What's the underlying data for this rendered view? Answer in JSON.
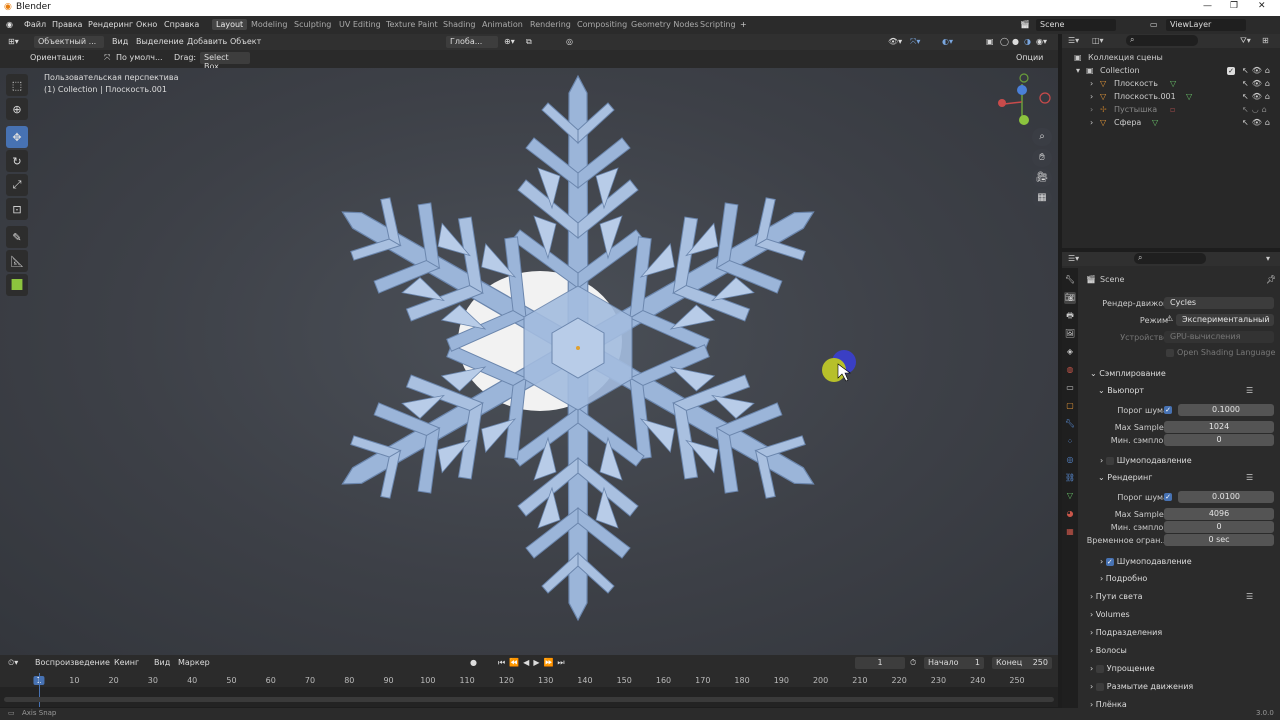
{
  "window": {
    "title": "Blender"
  },
  "menu": [
    "Файл",
    "Правка",
    "Рендеринг",
    "Окно",
    "Справка"
  ],
  "workspaces": [
    "Layout",
    "Modeling",
    "Sculpting",
    "UV Editing",
    "Texture Paint",
    "Shading",
    "Animation",
    "Rendering",
    "Compositing",
    "Geometry Nodes",
    "Scripting"
  ],
  "active_workspace": "Layout",
  "scene_field": "Scene",
  "viewlayer_field": "ViewLayer",
  "viewport_header": {
    "mode": "Объектный ...",
    "items": [
      "Вид",
      "Выделение",
      "Добавить",
      "Объект"
    ],
    "transform": "Глоба..."
  },
  "tool_header": {
    "orientation_label": "Ориентация:",
    "orientation_value": "По умолч...",
    "drag_label": "Drag:",
    "drag_value": "Select Box",
    "options": "Опции"
  },
  "viewport_info": {
    "line1": "Пользовательская перспектива",
    "line2": "(1) Collection | Плоскость.001"
  },
  "outliner": {
    "root": "Коллекция сцены",
    "collection": "Collection",
    "objects": [
      {
        "name": "Плоскость",
        "color": "#e8e8e8"
      },
      {
        "name": "Плоскость.001",
        "color": "#e8e8e8"
      },
      {
        "name": "Пустышка",
        "color": "#888888"
      },
      {
        "name": "Сфера",
        "color": "#e8e8e8"
      }
    ]
  },
  "properties": {
    "scene": "Scene",
    "render_engine_label": "Рендер-движок",
    "render_engine": "Cycles",
    "mode_label": "Режим",
    "mode": "Экспериментальный",
    "device_label": "Устройство",
    "device": "GPU-вычисления",
    "osl": "Open Shading Language",
    "sampling": "Сэмплирование",
    "viewport": "Вьюпорт",
    "noise_threshold_label": "Порог шума",
    "vp_noise": "0.1000",
    "max_samples_label": "Max Samples",
    "vp_max": "1024",
    "min_samples_label": "Мин. сэмплов",
    "vp_min": "0",
    "denoise": "Шумоподавление",
    "render": "Рендеринг",
    "r_noise": "0.0100",
    "r_max": "4096",
    "r_min": "0",
    "time_limit_label": "Временное огран...",
    "r_time": "0 sec",
    "advanced": "Подробно",
    "light_paths": "Пути света",
    "volumes": "Volumes",
    "subdivision": "Подразделения",
    "hair": "Волосы",
    "simplify": "Упрощение",
    "motion_blur": "Размытие движения",
    "film": "Плёнка"
  },
  "timeline": {
    "playback": "Воспроизведение",
    "keying": "Кеинг",
    "view": "Вид",
    "marker": "Маркер",
    "current": "1",
    "start_label": "Начало",
    "start": "1",
    "end_label": "Конец",
    "end": "250",
    "ticks": [
      "1",
      "10",
      "20",
      "30",
      "40",
      "50",
      "60",
      "70",
      "80",
      "90",
      "100",
      "110",
      "120",
      "130",
      "140",
      "150",
      "160",
      "170",
      "180",
      "190",
      "200",
      "210",
      "220",
      "230",
      "240",
      "250"
    ]
  },
  "status": {
    "left": "Axis Snap",
    "version": "3.0.0"
  },
  "colors": {
    "accent": "#4772b3",
    "snowflake": "#9bb5d9",
    "sphere_yellow": "#b7c02a",
    "sphere_blue": "#3a3fc4"
  }
}
